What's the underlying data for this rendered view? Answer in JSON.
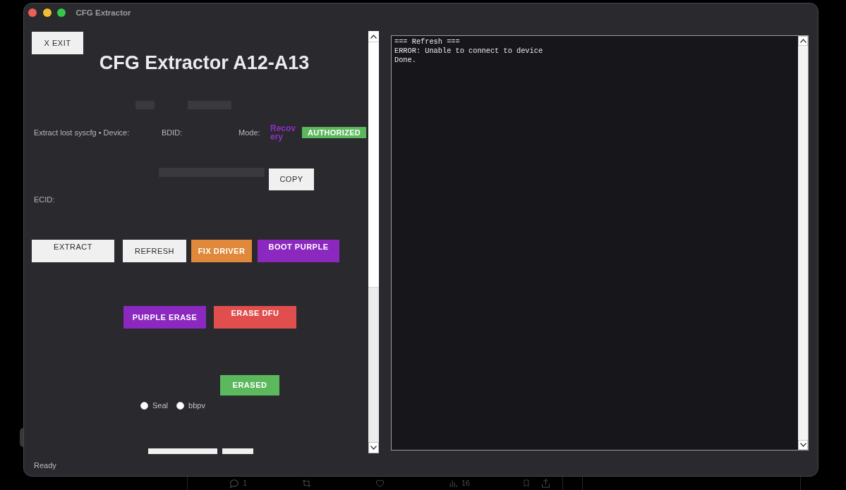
{
  "window": {
    "title": "CFG Extractor"
  },
  "exit_button": "X EXIT",
  "app_title": "CFG Extractor A12-A13",
  "device_info": {
    "device_label": "Extract lost syscfg • Device:",
    "bdid_label": "BDID:",
    "mode_label": "Mode:",
    "mode_value": "Recovery",
    "authorization_badge": "AUTHORIZED"
  },
  "copy_button": "COPY",
  "ecid_label": "ECID:",
  "actions": [
    {
      "label": "EXTRACT",
      "color": "#f0f0f0"
    },
    {
      "label": "REFRESH",
      "color": "#f0f0f0"
    },
    {
      "label": "FIX DRIVER",
      "color": "#e0893a"
    },
    {
      "label": "BOOT PURPLE",
      "color": "#8b28c0"
    }
  ],
  "erase_actions": [
    {
      "label": "PURPLE ERASE",
      "color": "#8b28c0"
    },
    {
      "label": "ERASE DFU",
      "color": "#e04f4d"
    }
  ],
  "erased_button": "ERASED",
  "radios": [
    {
      "label": "Seal",
      "selected": false
    },
    {
      "label": "bbpv",
      "selected": false
    }
  ],
  "status": "Ready",
  "log": {
    "lines": [
      "=== Refresh ===",
      "ERROR: Unable to connect to device",
      "Done."
    ]
  },
  "background_post": {
    "reply_count": "1",
    "view_count": "16"
  }
}
